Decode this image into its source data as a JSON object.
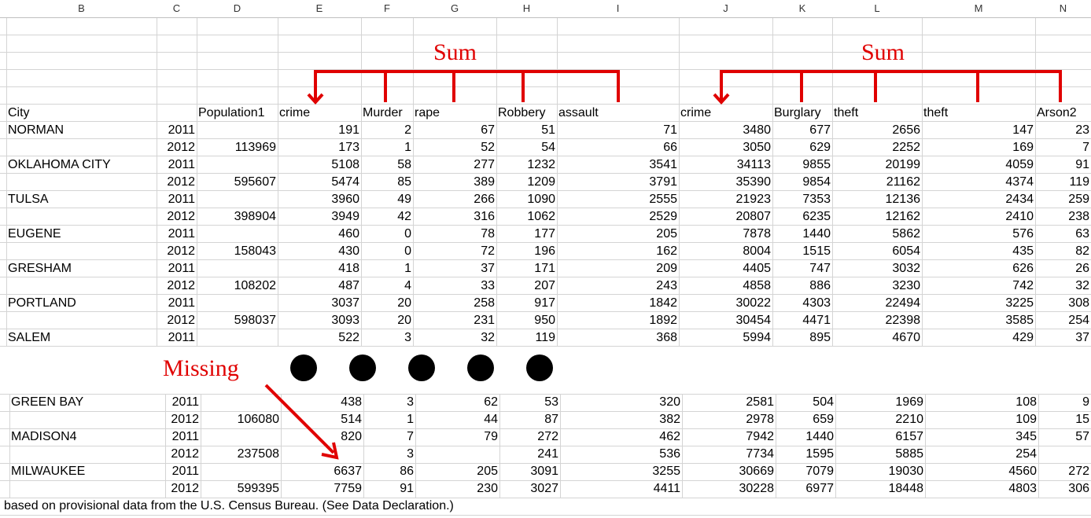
{
  "columns": [
    "B",
    "C",
    "D",
    "E",
    "F",
    "G",
    "H",
    "I",
    "J",
    "K",
    "L",
    "M",
    "N"
  ],
  "header_row": [
    "City",
    "",
    "Population1",
    "crime",
    "Murder",
    "rape",
    "Robbery",
    "assault",
    "crime",
    "Burglary",
    "theft",
    "theft",
    "Arson2"
  ],
  "rows_top": [
    [
      "NORMAN",
      "2011",
      "",
      "191",
      "2",
      "67",
      "51",
      "71",
      "3480",
      "677",
      "2656",
      "147",
      "23"
    ],
    [
      "",
      "2012",
      "113969",
      "173",
      "1",
      "52",
      "54",
      "66",
      "3050",
      "629",
      "2252",
      "169",
      "7"
    ],
    [
      "OKLAHOMA CITY",
      "2011",
      "",
      "5108",
      "58",
      "277",
      "1232",
      "3541",
      "34113",
      "9855",
      "20199",
      "4059",
      "91"
    ],
    [
      "",
      "2012",
      "595607",
      "5474",
      "85",
      "389",
      "1209",
      "3791",
      "35390",
      "9854",
      "21162",
      "4374",
      "119"
    ],
    [
      "TULSA",
      "2011",
      "",
      "3960",
      "49",
      "266",
      "1090",
      "2555",
      "21923",
      "7353",
      "12136",
      "2434",
      "259"
    ],
    [
      "",
      "2012",
      "398904",
      "3949",
      "42",
      "316",
      "1062",
      "2529",
      "20807",
      "6235",
      "12162",
      "2410",
      "238"
    ],
    [
      "EUGENE",
      "2011",
      "",
      "460",
      "0",
      "78",
      "177",
      "205",
      "7878",
      "1440",
      "5862",
      "576",
      "63"
    ],
    [
      "",
      "2012",
      "158043",
      "430",
      "0",
      "72",
      "196",
      "162",
      "8004",
      "1515",
      "6054",
      "435",
      "82"
    ],
    [
      "GRESHAM",
      "2011",
      "",
      "418",
      "1",
      "37",
      "171",
      "209",
      "4405",
      "747",
      "3032",
      "626",
      "26"
    ],
    [
      "",
      "2012",
      "108202",
      "487",
      "4",
      "33",
      "207",
      "243",
      "4858",
      "886",
      "3230",
      "742",
      "32"
    ],
    [
      "PORTLAND",
      "2011",
      "",
      "3037",
      "20",
      "258",
      "917",
      "1842",
      "30022",
      "4303",
      "22494",
      "3225",
      "308"
    ],
    [
      "",
      "2012",
      "598037",
      "3093",
      "20",
      "231",
      "950",
      "1892",
      "30454",
      "4471",
      "22398",
      "3585",
      "254"
    ],
    [
      "SALEM",
      "2011",
      "",
      "522",
      "3",
      "32",
      "119",
      "368",
      "5994",
      "895",
      "4670",
      "429",
      "37"
    ]
  ],
  "rows_bottom": [
    [
      "GREEN BAY",
      "2011",
      "",
      "438",
      "3",
      "62",
      "53",
      "320",
      "2581",
      "504",
      "1969",
      "108",
      "9"
    ],
    [
      "",
      "2012",
      "106080",
      "514",
      "1",
      "44",
      "87",
      "382",
      "2978",
      "659",
      "2210",
      "109",
      "15"
    ],
    [
      "MADISON4",
      "2011",
      "",
      "820",
      "7",
      "79",
      "272",
      "462",
      "7942",
      "1440",
      "6157",
      "345",
      "57"
    ],
    [
      "",
      "2012",
      "237508",
      "",
      "3",
      "",
      "241",
      "536",
      "7734",
      "1595",
      "5885",
      "254",
      ""
    ],
    [
      "MILWAUKEE",
      "2011",
      "",
      "6637",
      "86",
      "205",
      "3091",
      "3255",
      "30669",
      "7079",
      "19030",
      "4560",
      "272"
    ],
    [
      "",
      "2012",
      "599395",
      "7759",
      "91",
      "230",
      "3027",
      "4411",
      "30228",
      "6977",
      "18448",
      "4803",
      "306"
    ]
  ],
  "footer_note": "based on provisional data from the U.S. Census Bureau.  (See Data Declaration.)",
  "annotations": {
    "sum_left": "Sum",
    "sum_right": "Sum",
    "missing": "Missing",
    "accent_color": "#e00000"
  }
}
